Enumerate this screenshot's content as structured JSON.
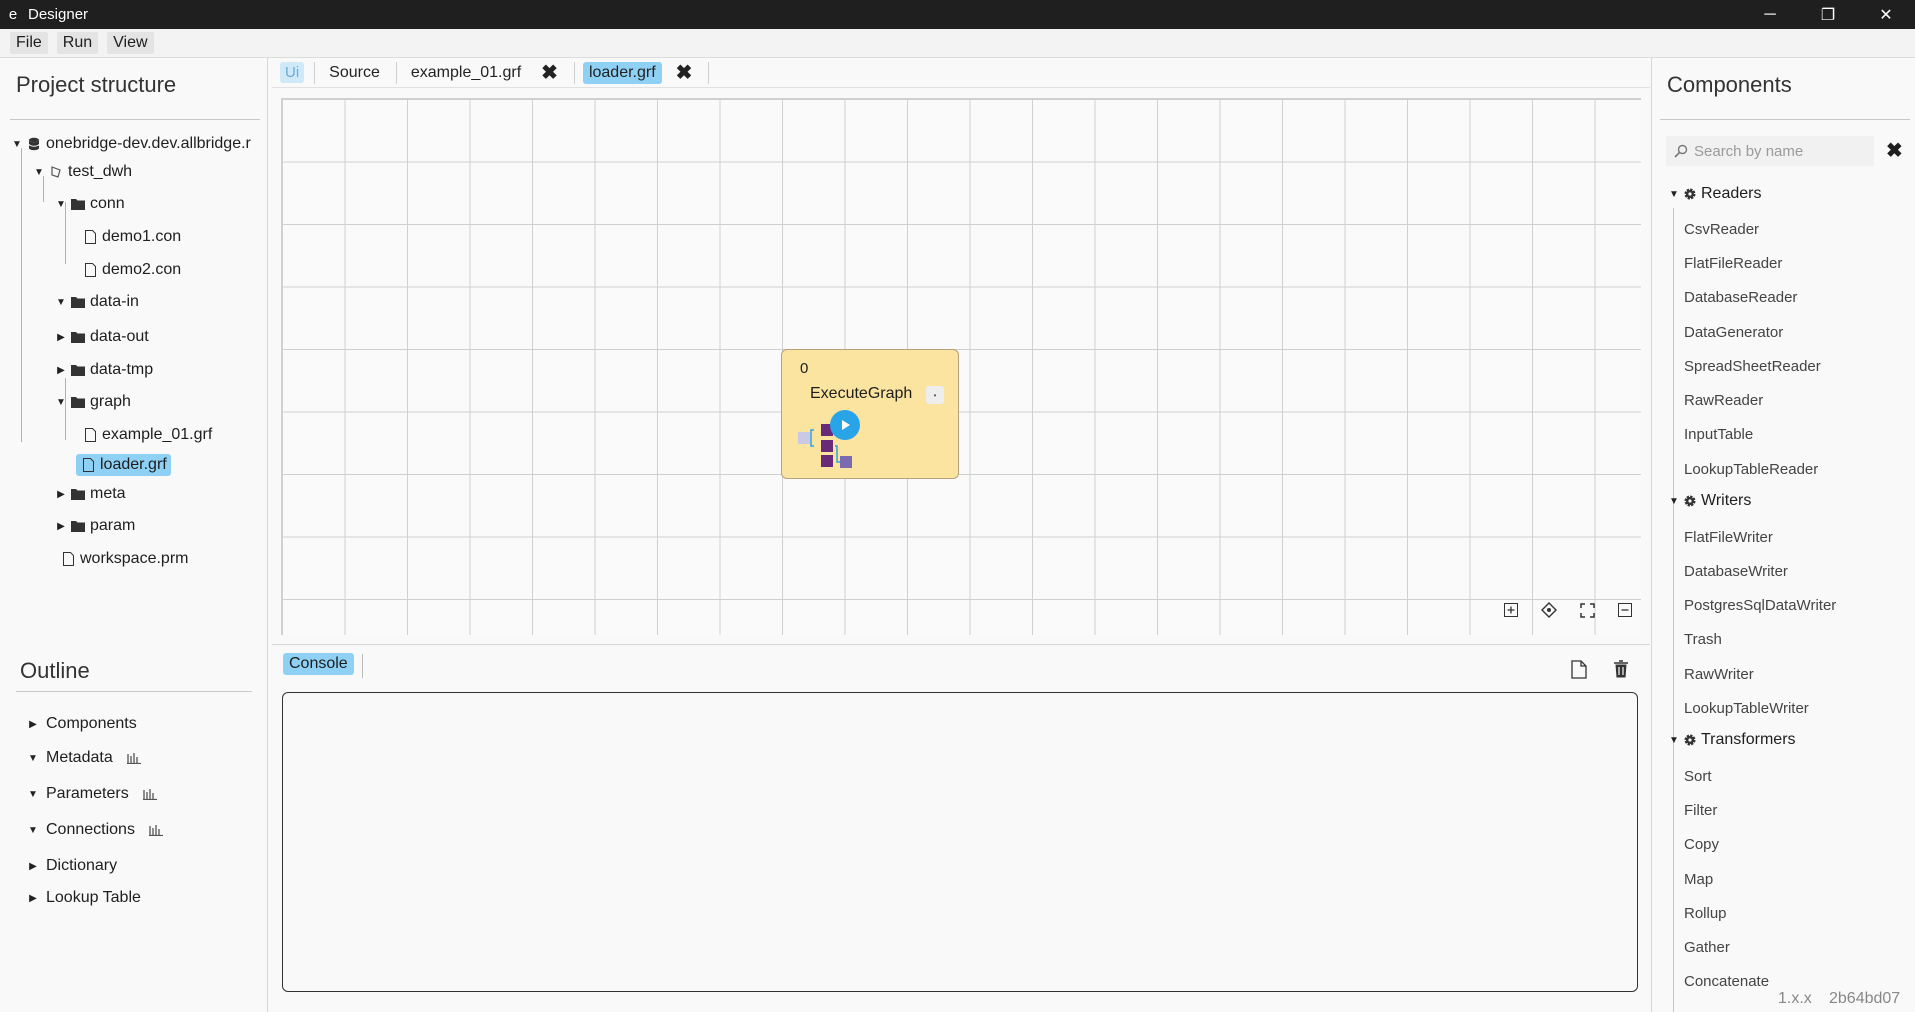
{
  "window": {
    "app_icon": "e",
    "title": "Designer",
    "controls": {
      "minimize": "─",
      "restore": "❐",
      "close": "✕"
    }
  },
  "menu": [
    "File",
    "Run",
    "View"
  ],
  "project": {
    "heading": "Project structure",
    "tree": {
      "root": "onebridge-dev.dev.allbridge.r",
      "workspace": "test_dwh",
      "conn": "conn",
      "demo1": "demo1.con",
      "demo2": "demo2.con",
      "data_in": "data-in",
      "data_out": "data-out",
      "data_tmp": "data-tmp",
      "graph": "graph",
      "example": "example_01.grf",
      "loader": "loader.grf",
      "meta": "meta",
      "param": "param",
      "workspace_prm": "workspace.prm"
    }
  },
  "outline": {
    "heading": "Outline",
    "items": [
      "Components",
      "Metadata",
      "Parameters",
      "Connections",
      "Dictionary",
      "Lookup Table"
    ]
  },
  "tabs": {
    "ui": "Ui",
    "source": "Source",
    "example": "example_01.grf",
    "loader": "loader.grf",
    "close_glyph": "✖"
  },
  "node": {
    "id": "0",
    "name": "ExecuteGraph",
    "port_glyph": "•"
  },
  "console": {
    "tab": "Console"
  },
  "components": {
    "heading": "Components",
    "search_placeholder": "Search by name",
    "clear_glyph": "✖",
    "readers_label": "Readers",
    "readers": [
      "CsvReader",
      "FlatFileReader",
      "DatabaseReader",
      "DataGenerator",
      "SpreadSheetReader",
      "RawReader",
      "InputTable",
      "LookupTableReader"
    ],
    "writers_label": "Writers",
    "writers": [
      "FlatFileWriter",
      "DatabaseWriter",
      "PostgresSqlDataWriter",
      "Trash",
      "RawWriter",
      "LookupTableWriter"
    ],
    "transformers_label": "Transformers",
    "transformers": [
      "Sort",
      "Filter",
      "Copy",
      "Map",
      "Rollup",
      "Gather",
      "Concatenate"
    ]
  },
  "footer": {
    "version": "1.x.x",
    "commit": "2b64bd07"
  },
  "icons": {
    "expanded": "▼",
    "collapsed": "▶"
  },
  "colors": {
    "selection": "#8fd0f5",
    "node_fill": "#fbe3a0",
    "play": "#2aa4e8",
    "titlebar": "#1f1f1f"
  }
}
